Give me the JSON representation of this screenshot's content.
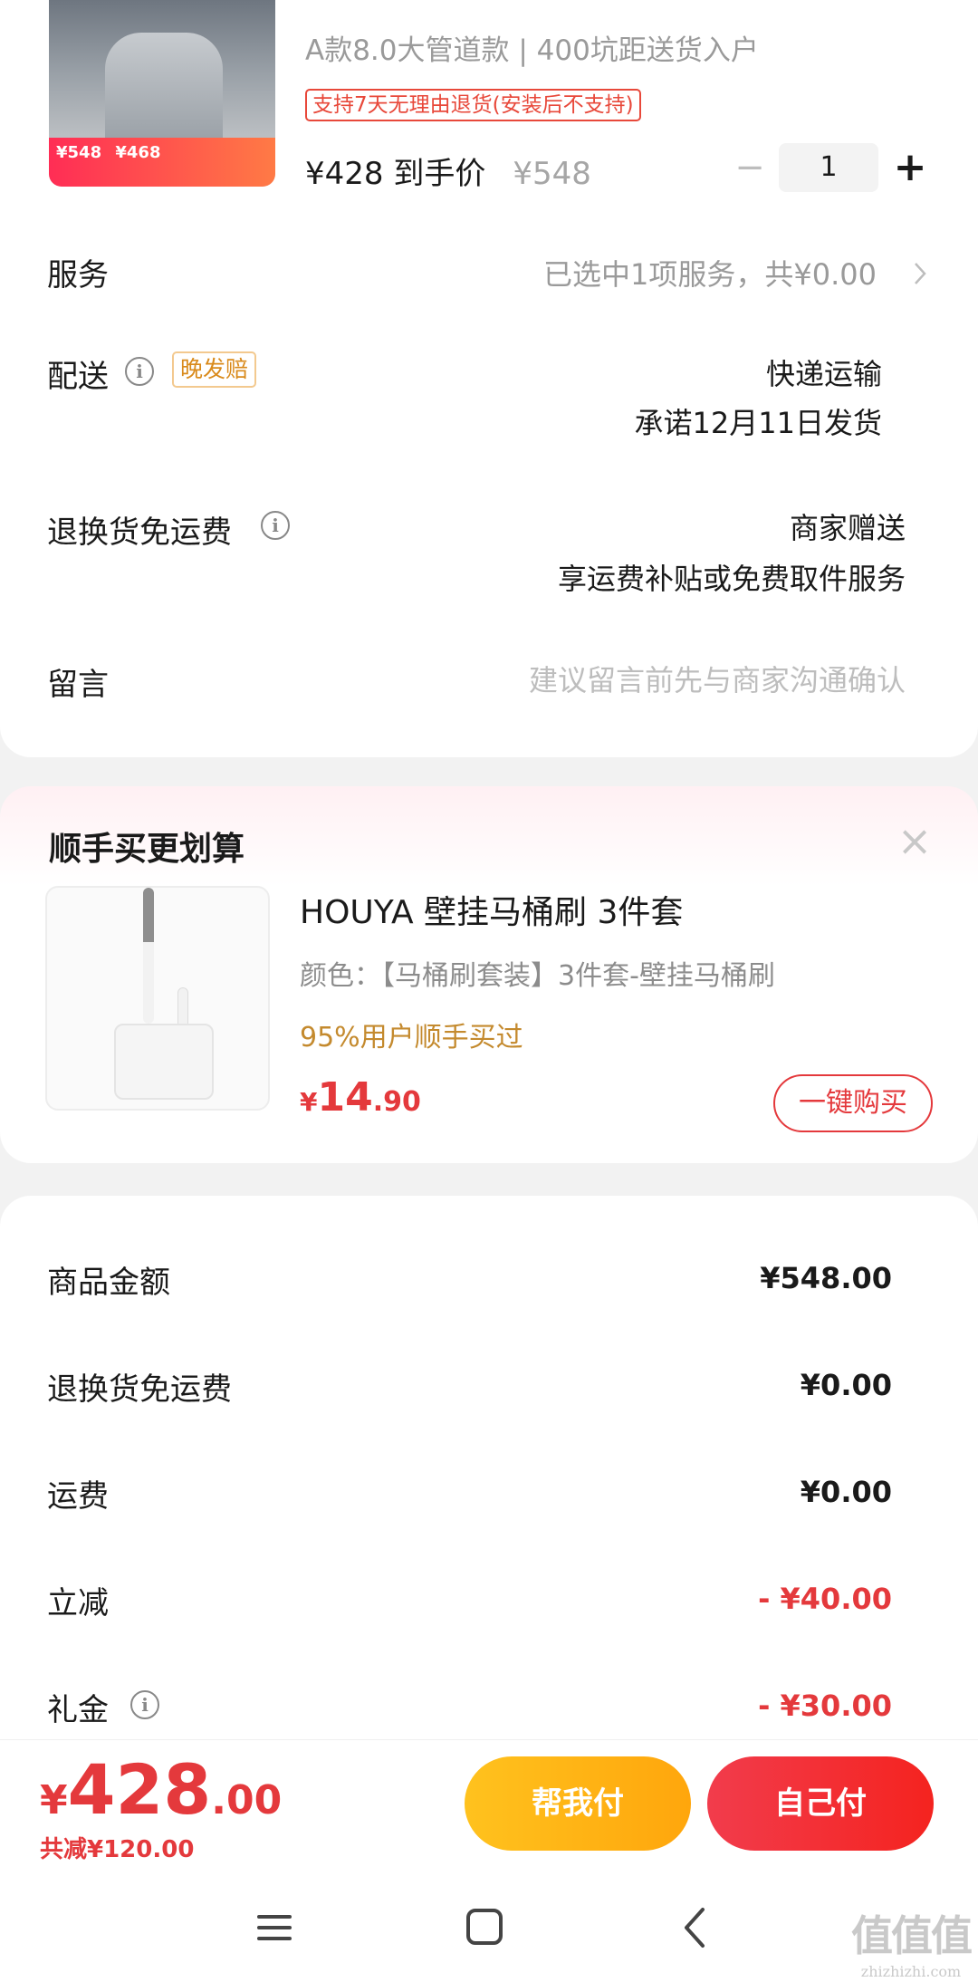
{
  "product": {
    "image_promo_price": "¥548",
    "image_promo_deal": "¥468",
    "title": "A款8.0大管道款 | 400坑距送货入户",
    "return_tag": "支持7天无理由退货(安装后不支持)",
    "price": "¥428 到手价",
    "original_price": "¥548",
    "quantity": "1",
    "minus_label": "−",
    "plus_label": "+"
  },
  "rows": {
    "service_label": "服务",
    "service_value": "已选中1项服务，共¥0.00",
    "delivery_label": "配送",
    "delivery_badge": "晚发赔",
    "delivery_method": "快递运输",
    "delivery_promise": "承诺12月11日发货",
    "return_free_label": "退换货免运费",
    "return_free_value": "商家赠送",
    "return_free_desc": "享运费补贴或免费取件服务",
    "message_label": "留言",
    "message_placeholder": "建议留言前先与商家沟通确认"
  },
  "upsell": {
    "title": "顺手买更划算",
    "name": "HOUYA 壁挂马桶刷 3件套",
    "spec": "颜色：【马桶刷套装】3件套-壁挂马桶刷",
    "bought": "95%用户顺手买过",
    "price_symbol": "¥",
    "price_int": "14",
    "price_dec": ".90",
    "buy_label": "一键购买"
  },
  "summary": {
    "goods_label": "商品金额",
    "goods_value": "¥548.00",
    "return_label": "退换货免运费",
    "return_value": "¥0.00",
    "shipping_label": "运费",
    "shipping_value": "¥0.00",
    "discount_label": "立减",
    "discount_value": "- ¥40.00",
    "gift_label": "礼金",
    "gift_value": "- ¥30.00"
  },
  "bottom": {
    "total_symbol": "¥",
    "total_int": "428",
    "total_dec": ".00",
    "saved": "共减¥120.00",
    "help_pay": "帮我付",
    "self_pay": "自己付"
  },
  "watermark": {
    "big": "值值值",
    "small": "zhizhizhi.com"
  },
  "colors": {
    "accent": "#e4393c",
    "gold": "#c48a2e",
    "help_button": "#ffb416",
    "self_button": "#f2303a"
  }
}
